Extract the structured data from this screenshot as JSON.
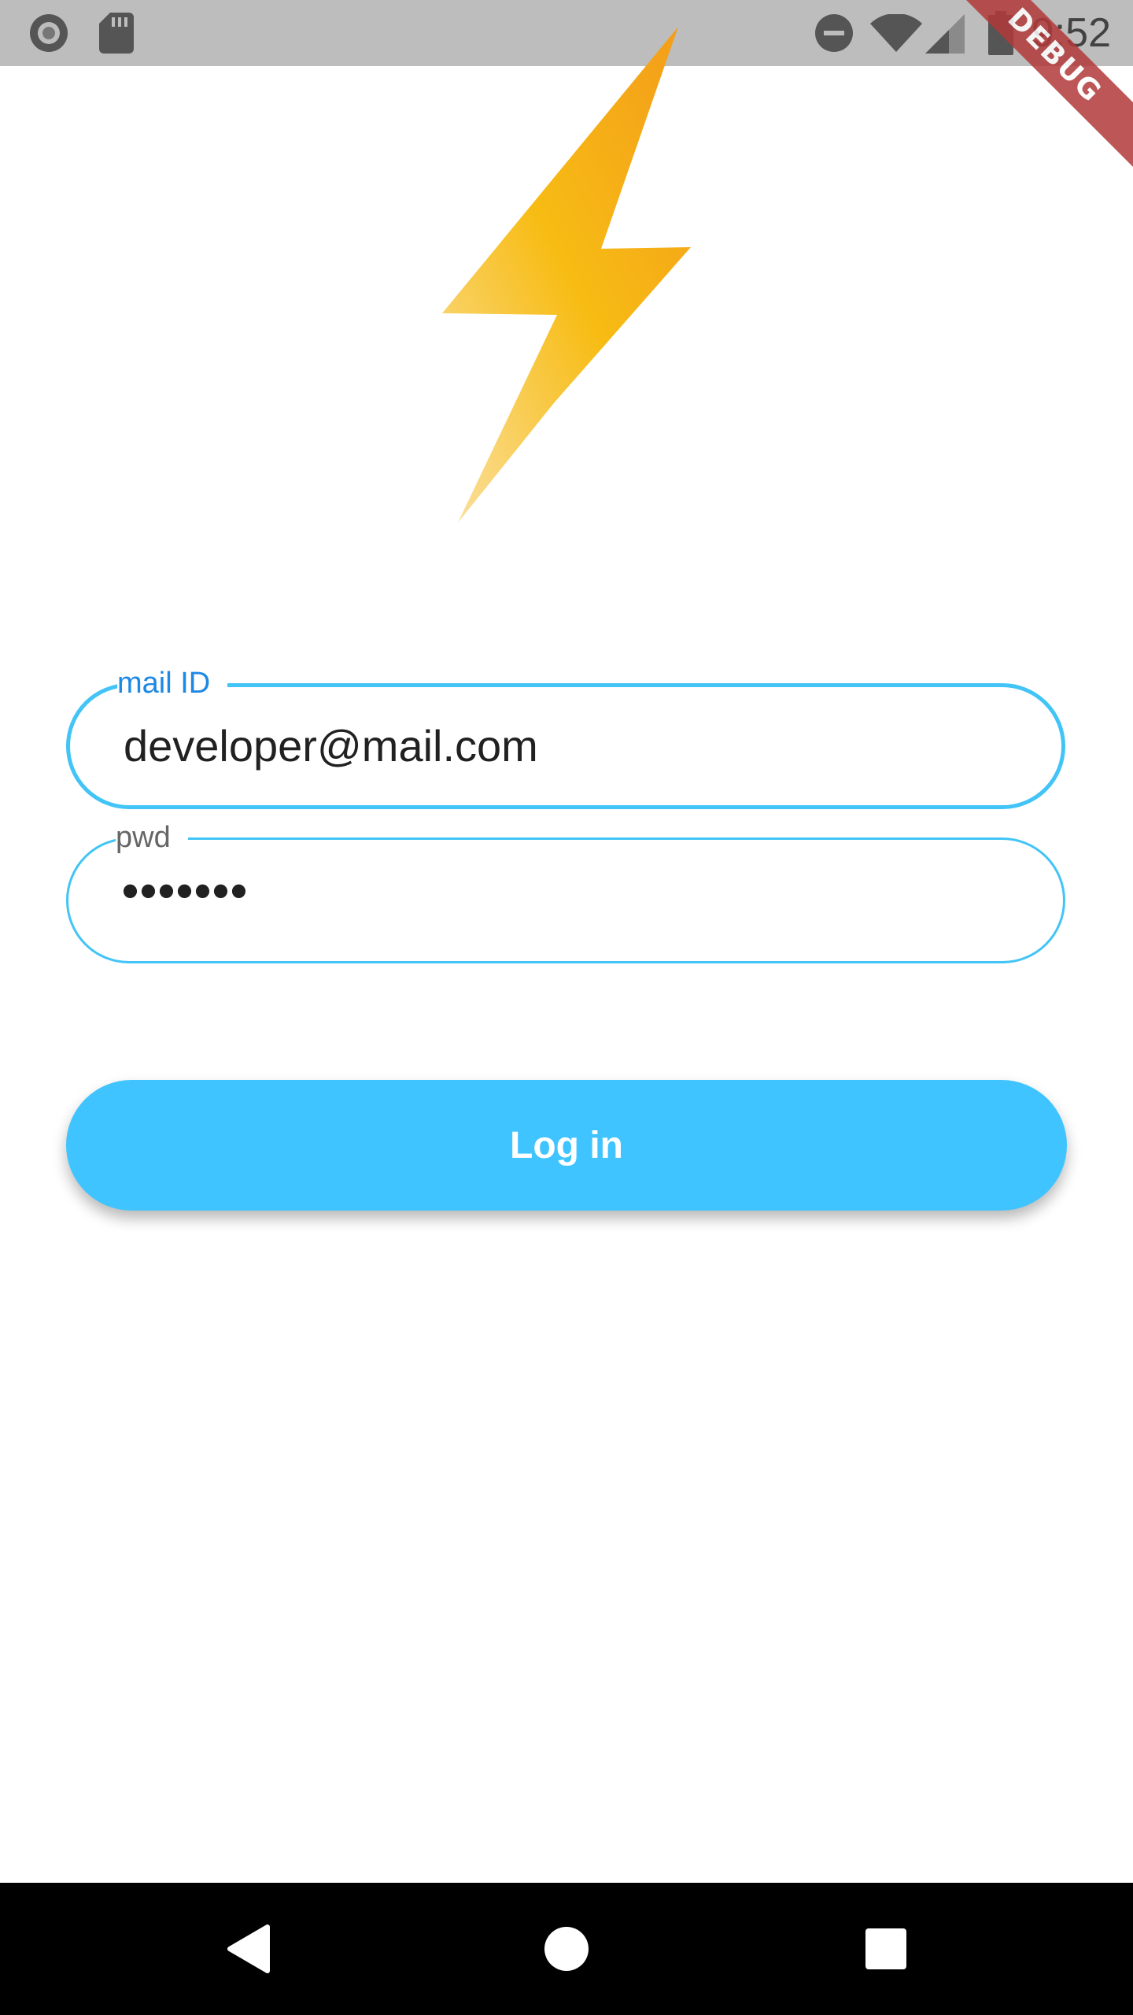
{
  "status_bar": {
    "time": "9:52",
    "icons": [
      "record-icon",
      "sd-card-icon",
      "do-not-disturb-icon",
      "wifi-icon",
      "signal-icon",
      "battery-icon"
    ]
  },
  "debug_banner": "DEBUG",
  "logo": {
    "icon": "lightning-bolt-icon",
    "colors": [
      "#f5a623",
      "#f7b914",
      "#fbd36a"
    ]
  },
  "form": {
    "email": {
      "label": "mail ID",
      "value": "developer@mail.com"
    },
    "password": {
      "label": "pwd",
      "value": "•••••••"
    }
  },
  "login_button": {
    "label": "Log in"
  },
  "nav_bar": {
    "buttons": [
      "back-icon",
      "home-icon",
      "recents-icon"
    ]
  },
  "colors": {
    "accent": "#40c4ff",
    "label_focused": "#1e88e5",
    "logo": "#f7b914"
  }
}
